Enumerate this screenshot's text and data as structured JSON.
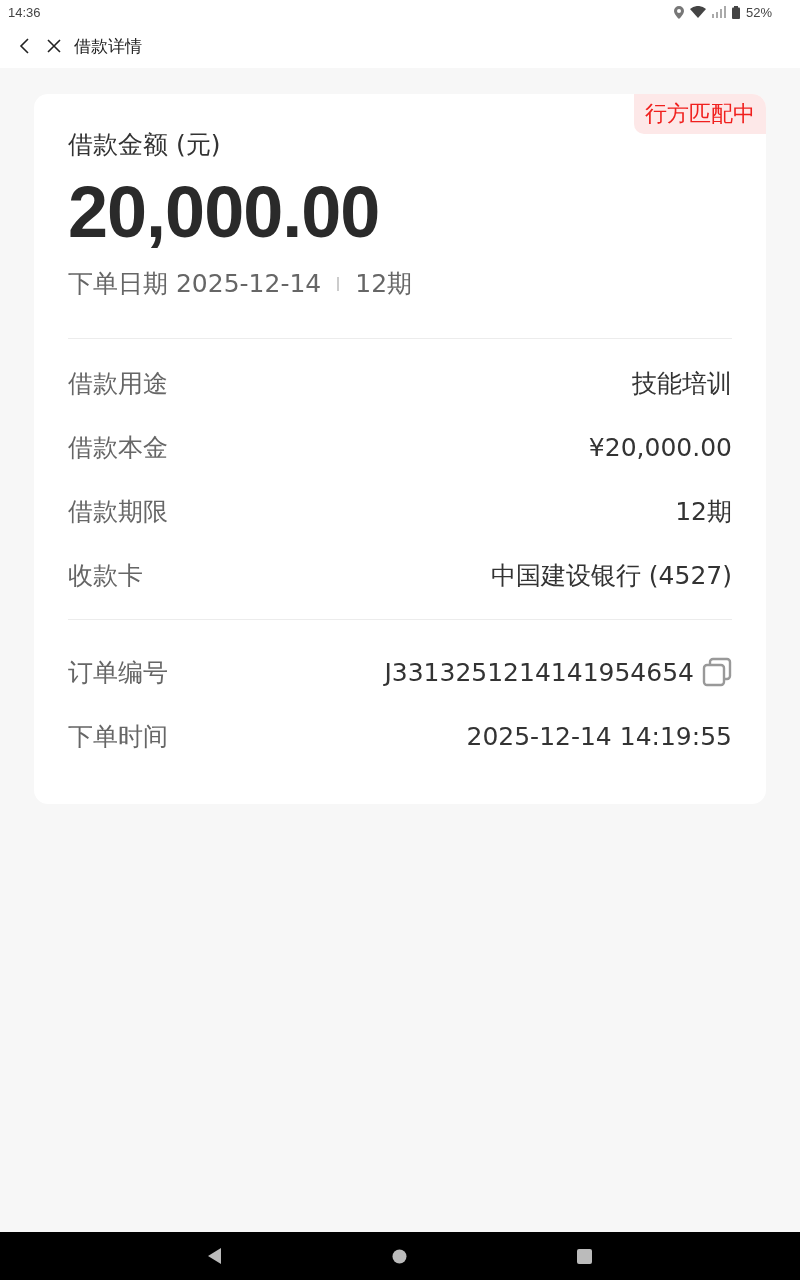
{
  "status_bar": {
    "time": "14:36",
    "battery": "52%"
  },
  "header": {
    "title": "借款详情"
  },
  "card": {
    "badge": "行方匹配中",
    "amount_label": "借款金额 (元)",
    "amount": "20,000.00",
    "order_date": "下单日期 2025-12-14",
    "term": "12期",
    "sections": [
      {
        "rows": [
          {
            "label": "借款用途",
            "value": "技能培训",
            "kind": "plain"
          },
          {
            "label": "借款本金",
            "value": "¥20,000.00",
            "kind": "plain"
          },
          {
            "label": "借款期限",
            "value": "12期",
            "kind": "plain"
          },
          {
            "label": "收款卡",
            "value": "中国建设银行 (4527)",
            "kind": "plain"
          }
        ]
      },
      {
        "rows": [
          {
            "label": "订单编号",
            "value": "J3313251214141954654",
            "kind": "copy"
          },
          {
            "label": "下单时间",
            "value": "2025-12-14 14:19:55",
            "kind": "plain"
          }
        ]
      }
    ]
  }
}
